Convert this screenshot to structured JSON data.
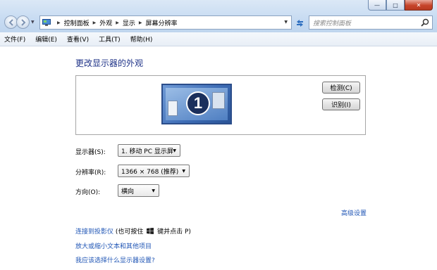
{
  "window": {
    "minimize_glyph": "—",
    "maximize_glyph": "□",
    "close_glyph": "✕"
  },
  "nav": {
    "back_icon": "back-arrow-icon",
    "forward_icon": "forward-arrow-icon"
  },
  "address": {
    "crumbs": [
      "控制面板",
      "外观",
      "显示",
      "屏幕分辨率"
    ]
  },
  "search": {
    "placeholder": "搜索控制面板"
  },
  "menu": [
    "文件(F)",
    "编辑(E)",
    "查看(V)",
    "工具(T)",
    "帮助(H)"
  ],
  "main": {
    "heading": "更改显示器的外观",
    "monitor_number": "1",
    "detect_label": "检测(C)",
    "identify_label": "识别(I)",
    "display_label": "显示器(S):",
    "display_value": "1. 移动 PC 显示屏",
    "resolution_label": "分辨率(R):",
    "resolution_value": "1366 × 768 (推荐)",
    "orientation_label": "方向(O):",
    "orientation_value": "横向",
    "advanced_link": "高级设置",
    "projector_link": "连接到投影仪",
    "projector_hint_prefix": " (也可按住 ",
    "projector_hint_suffix": " 键并点击 P)",
    "text_size_link": "放大或缩小文本和其他项目",
    "which_settings_link": "我应该选择什么显示器设置?"
  },
  "colors": {
    "heading": "#1e3287",
    "link": "#1f55b5",
    "accent": "#3e6db6"
  }
}
